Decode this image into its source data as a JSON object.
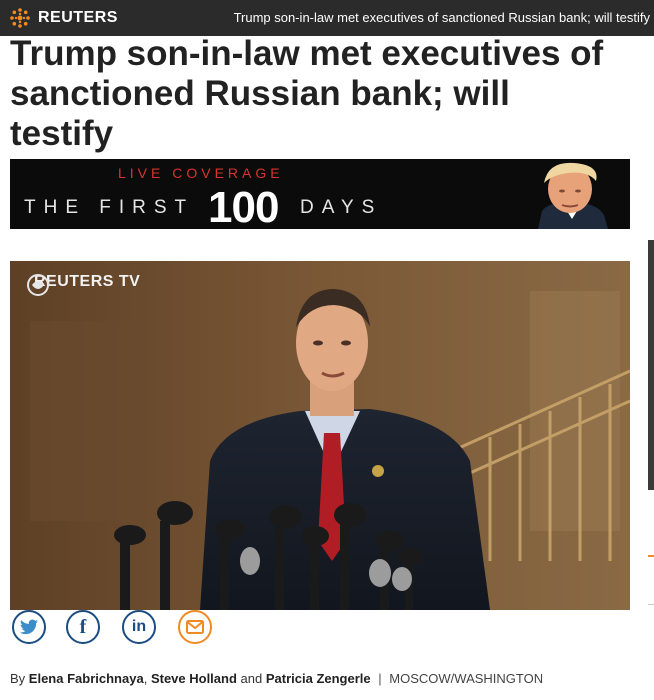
{
  "site": {
    "brand": "REUTERS"
  },
  "topbar": {
    "headline": "Trump son-in-law met executives of sanctioned Russian bank; will testify"
  },
  "article": {
    "headline_lines": [
      "Trump son-in-law met executives of",
      "sanctioned Russian bank; will",
      "testify"
    ]
  },
  "banner": {
    "live_label": "LIVE COVERAGE",
    "the_first": "THE FIRST",
    "number": "100",
    "days": "DAYS"
  },
  "video": {
    "brand": "REUTERS TV"
  },
  "share": {
    "buttons": [
      {
        "name": "twitter",
        "glyph": "t"
      },
      {
        "name": "facebook",
        "glyph": "f"
      },
      {
        "name": "linkedin",
        "glyph": "in"
      },
      {
        "name": "email",
        "glyph": "✉"
      }
    ]
  },
  "byline": {
    "prefix": "By",
    "author1": "Elena Fabrichnaya",
    "comma": ",",
    "author2": "Steve Holland",
    "and": "and",
    "author3": "Patricia Zengerle",
    "separator": "|",
    "dateline": "MOSCOW/WASHINGTON"
  },
  "colors": {
    "topbar_bg": "#2b2b2b",
    "brand_orange": "#f28c1e",
    "share_blue": "#1b4d83",
    "email_orange": "#f08a24",
    "live_red": "#d9332c"
  }
}
